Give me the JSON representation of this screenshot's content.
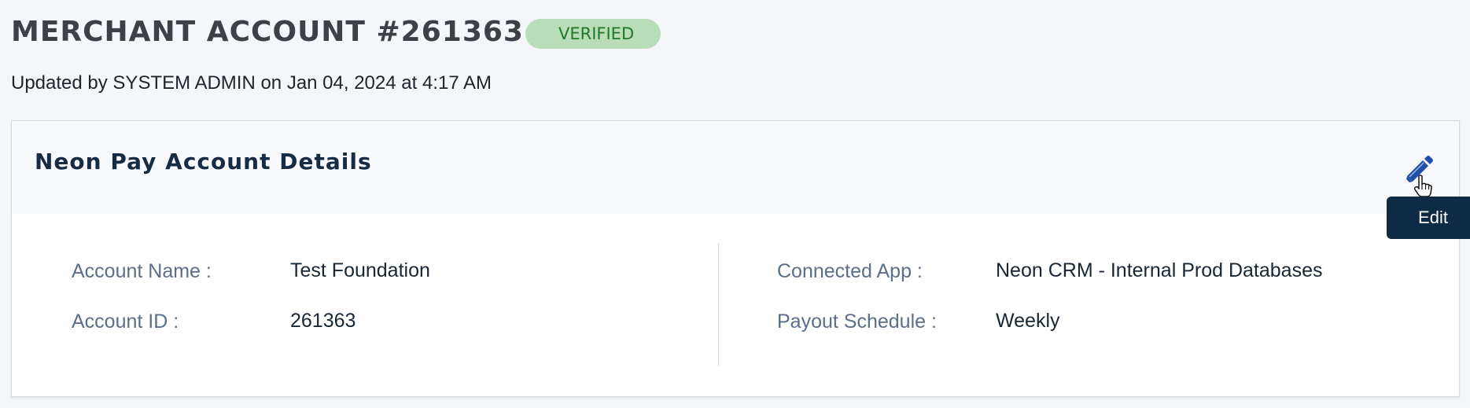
{
  "header": {
    "title": "MERCHANT ACCOUNT #261363",
    "status_badge": "VERIFIED",
    "updated_line": "Updated by SYSTEM ADMIN on Jan 04, 2024 at 4:17 AM"
  },
  "card": {
    "title": "Neon Pay Account Details",
    "edit_tooltip": "Edit",
    "left_fields": [
      {
        "label": "Account Name :",
        "value": "Test Foundation"
      },
      {
        "label": "Account ID :",
        "value": "261363"
      }
    ],
    "right_fields": [
      {
        "label": "Connected App :",
        "value": "Neon CRM - Internal Prod Databases"
      },
      {
        "label": "Payout Schedule :",
        "value": "Weekly"
      }
    ]
  },
  "icons": {
    "edit": "pencil-icon",
    "cursor": "hand-pointer-icon"
  },
  "colors": {
    "badge_bg": "#b9dcb9",
    "badge_text": "#217a2a",
    "edit_icon": "#1f4fa8",
    "tooltip_bg": "#0f2a44"
  }
}
